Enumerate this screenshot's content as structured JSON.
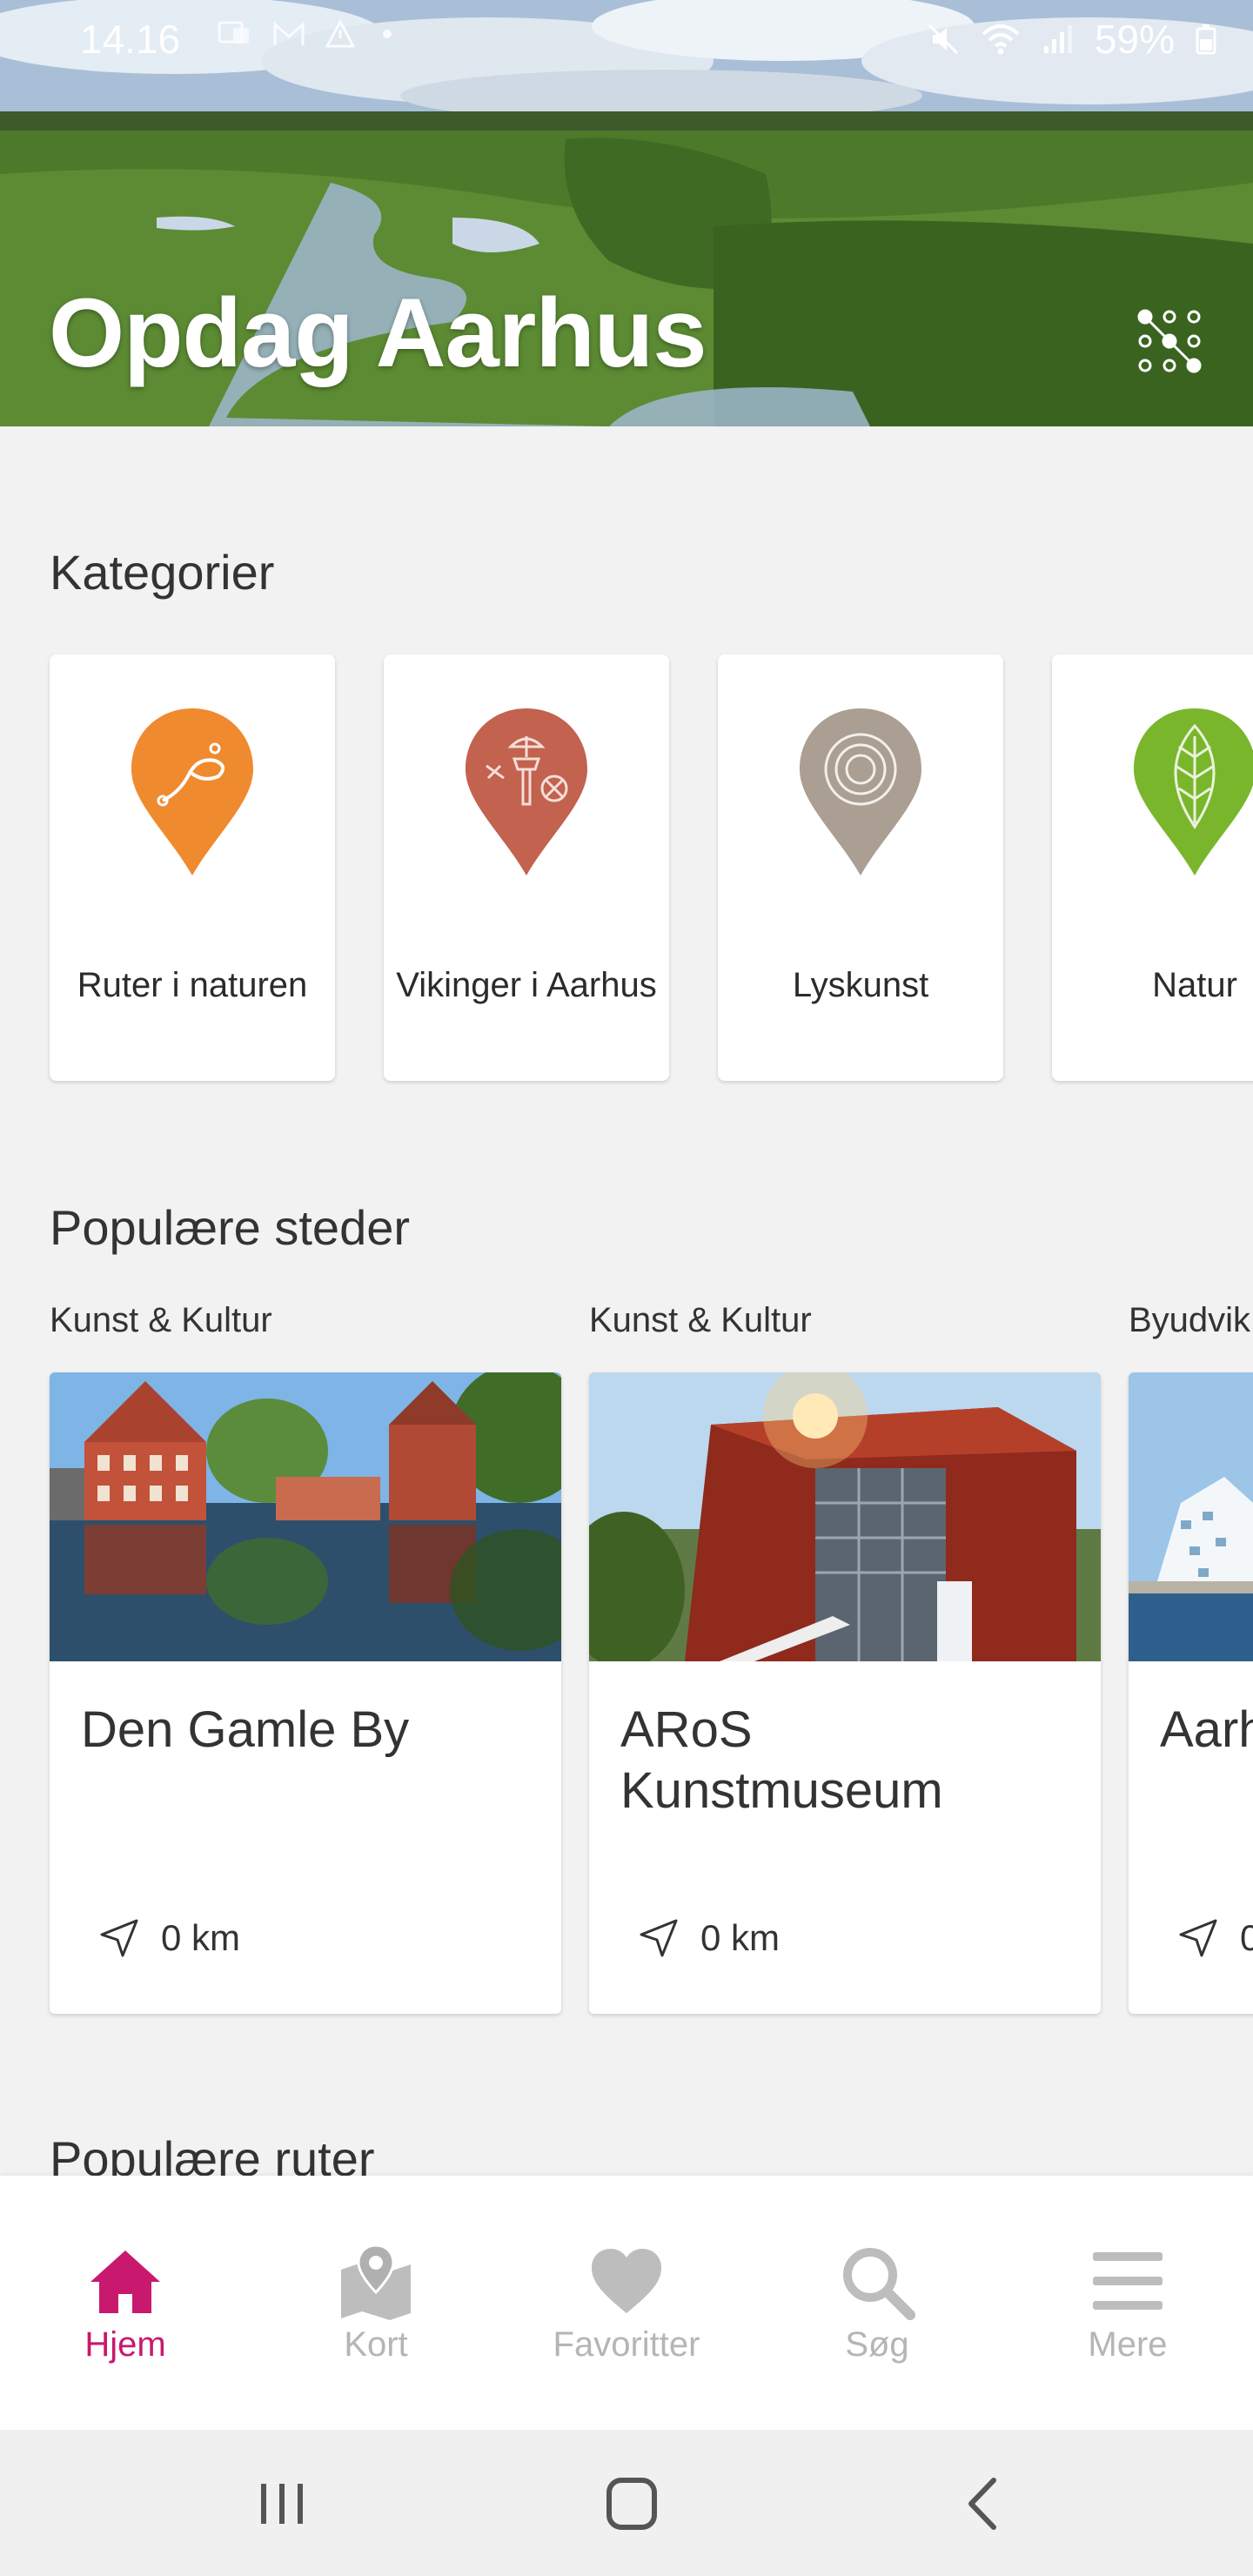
{
  "status_bar": {
    "time": "14.16",
    "battery": "59%"
  },
  "hero": {
    "title": "Opdag Aarhus"
  },
  "sections": {
    "categories_title": "Kategorier",
    "popular_places_title": "Populære steder",
    "popular_routes_title": "Populære ruter"
  },
  "categories": [
    {
      "label": "Ruter i naturen",
      "color": "#f08a2e",
      "icon": "route-pin-icon"
    },
    {
      "label": "Vikinger i Aarhus",
      "color": "#c2624f",
      "icon": "viking-pin-icon"
    },
    {
      "label": "Lyskunst",
      "color": "#ab9e92",
      "icon": "light-art-pin-icon"
    },
    {
      "label": "Natur",
      "color": "#7ab62c",
      "icon": "leaf-pin-icon"
    }
  ],
  "places": [
    {
      "category": "Kunst & Kultur",
      "name": "Den Gamle By",
      "distance": "0 km"
    },
    {
      "category": "Kunst & Kultur",
      "name": "ARoS Kunstmuseum",
      "distance": "0 km"
    },
    {
      "category": "Byudvik",
      "name": "Aarh",
      "distance": "0"
    }
  ],
  "bottom_nav": [
    {
      "label": "Hjem",
      "icon": "home-icon",
      "active": true
    },
    {
      "label": "Kort",
      "icon": "map-pin-icon",
      "active": false
    },
    {
      "label": "Favoritter",
      "icon": "heart-icon",
      "active": false
    },
    {
      "label": "Søg",
      "icon": "search-icon",
      "active": false
    },
    {
      "label": "Mere",
      "icon": "menu-icon",
      "active": false
    }
  ],
  "colors": {
    "accent": "#c8196e",
    "inactive": "#b5b5b5"
  }
}
